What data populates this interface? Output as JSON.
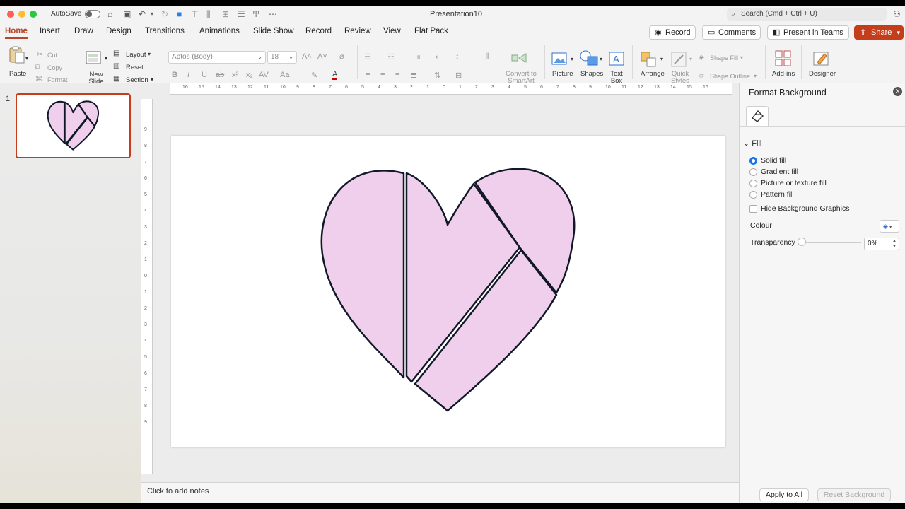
{
  "app": {
    "autosave_label": "AutoSave",
    "doc_title": "Presentation10",
    "search_placeholder": "Search (Cmd + Ctrl + U)"
  },
  "tabs": [
    "Home",
    "Insert",
    "Draw",
    "Design",
    "Transitions",
    "Animations",
    "Slide Show",
    "Record",
    "Review",
    "View",
    "Flat Pack"
  ],
  "active_tab": "Home",
  "actions": {
    "record": "Record",
    "comments": "Comments",
    "present": "Present in Teams",
    "share": "Share"
  },
  "ribbon": {
    "paste": "Paste",
    "cut": "Cut",
    "copy": "Copy",
    "format": "Format",
    "new_slide": "New Slide",
    "layout": "Layout",
    "reset": "Reset",
    "section": "Section",
    "font_name": "Aptos (Body)",
    "font_size": "18",
    "convert_smartart": "Convert to SmartArt",
    "picture": "Picture",
    "shapes": "Shapes",
    "text_box": "Text Box",
    "arrange": "Arrange",
    "quick_styles": "Quick Styles",
    "shape_fill": "Shape Fill",
    "shape_outline": "Shape Outline",
    "add_ins": "Add-ins",
    "designer": "Designer"
  },
  "thumbnails": [
    {
      "number": "1"
    }
  ],
  "notes_placeholder": "Click to add notes",
  "format_pane": {
    "title": "Format Background",
    "section": "Fill",
    "options": [
      "Solid fill",
      "Gradient fill",
      "Picture or texture fill",
      "Pattern fill"
    ],
    "selected_option": "Solid fill",
    "hide_bg_graphics": "Hide Background Graphics",
    "colour_label": "Colour",
    "transparency_label": "Transparency",
    "transparency_value": "0%",
    "apply_all": "Apply to All",
    "reset_bg": "Reset Background"
  },
  "colors": {
    "accent": "#b7472a",
    "share_bg": "#c43e1c",
    "heart_fill": "#f0cfec",
    "heart_stroke": "#111827"
  },
  "ruler": {
    "h_labels": [
      "16",
      "15",
      "14",
      "13",
      "12",
      "11",
      "10",
      "9",
      "8",
      "7",
      "6",
      "5",
      "4",
      "3",
      "2",
      "1",
      "0",
      "1",
      "2",
      "3",
      "4",
      "5",
      "6",
      "7",
      "8",
      "9",
      "10",
      "11",
      "12",
      "13",
      "14",
      "15",
      "16"
    ],
    "v_labels": [
      "9",
      "8",
      "7",
      "6",
      "5",
      "4",
      "3",
      "2",
      "1",
      "0",
      "1",
      "2",
      "3",
      "4",
      "5",
      "6",
      "7",
      "8",
      "9"
    ]
  }
}
